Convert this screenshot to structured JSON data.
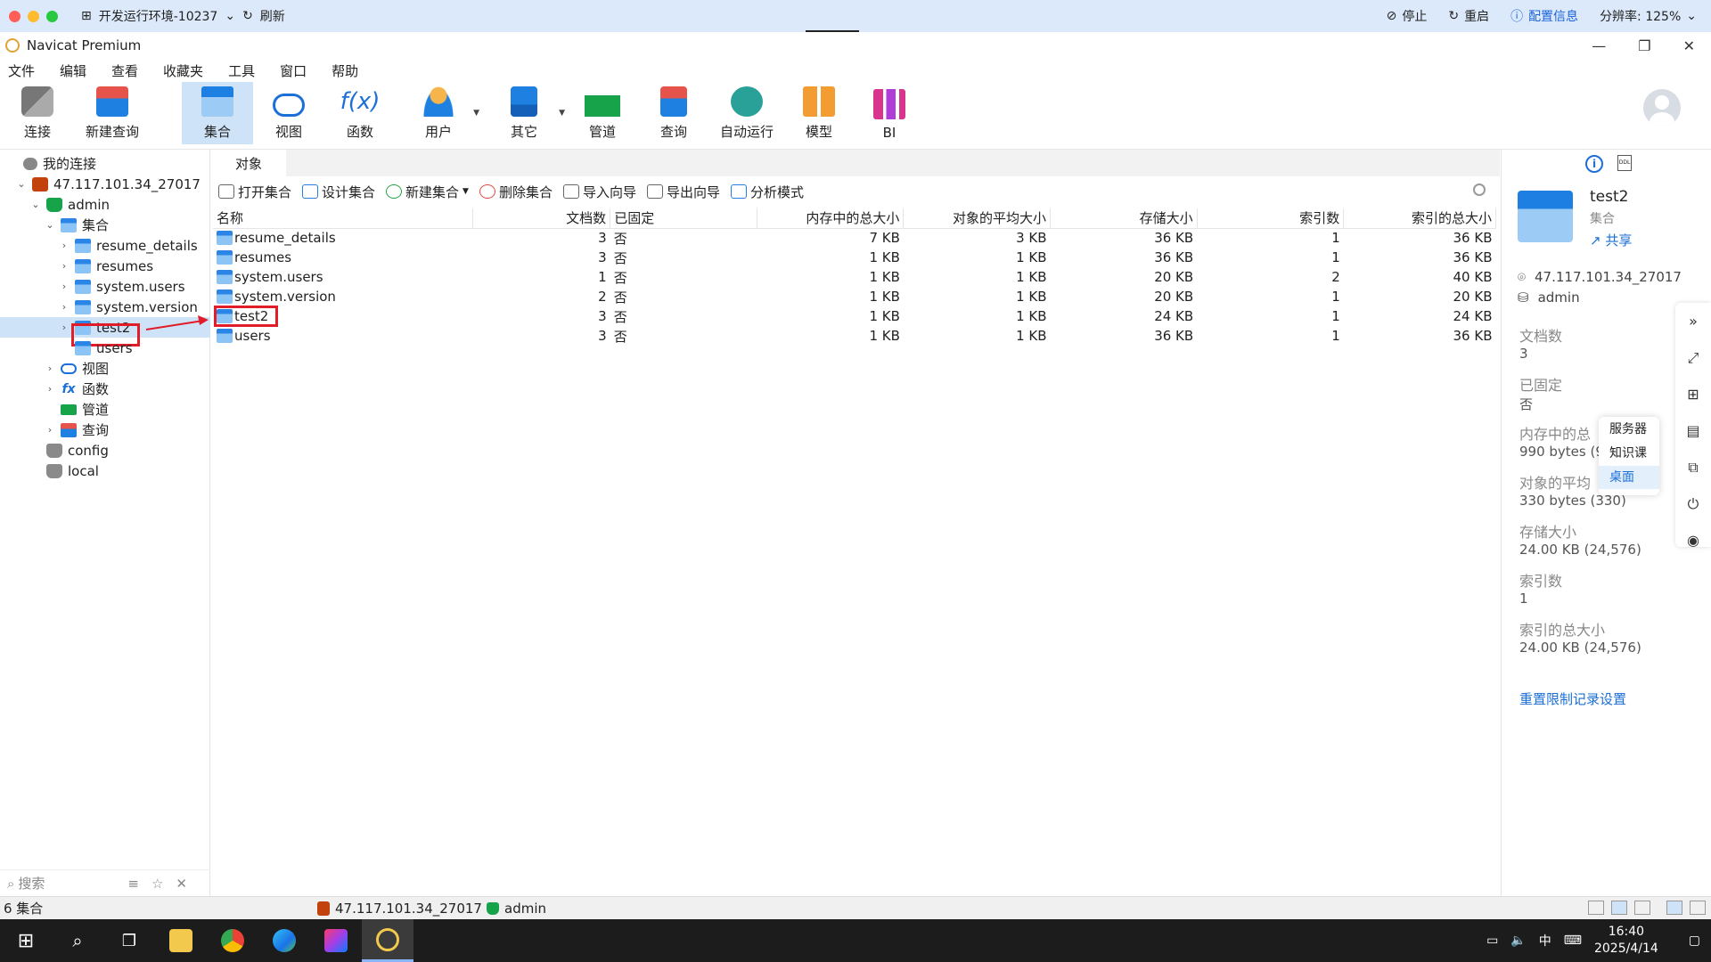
{
  "remote": {
    "env_title": "开发运行环境-10237",
    "refresh": "刷新",
    "stop": "停止",
    "restart": "重启",
    "config_info": "配置信息",
    "resolution": "分辨率: 125%"
  },
  "window": {
    "title": "Navicat Premium"
  },
  "menu": [
    "文件",
    "编辑",
    "查看",
    "收藏夹",
    "工具",
    "窗口",
    "帮助"
  ],
  "toolbar": [
    "连接",
    "新建查询",
    "集合",
    "视图",
    "函数",
    "用户",
    "其它",
    "管道",
    "查询",
    "自动运行",
    "模型",
    "BI"
  ],
  "tree": {
    "my_connections": "我的连接",
    "server": "47.117.101.34_27017",
    "db_admin": "admin",
    "collections": "集合",
    "items": [
      "resume_details",
      "resumes",
      "system.users",
      "system.version",
      "test2",
      "users"
    ],
    "views": "视图",
    "functions": "函数",
    "pipelines": "管道",
    "queries": "查询",
    "db_config": "config",
    "db_local": "local",
    "search_placeholder": "搜索"
  },
  "objects": {
    "tab": "对象",
    "actions": [
      "打开集合",
      "设计集合",
      "新建集合",
      "删除集合",
      "导入向导",
      "导出向导",
      "分析模式"
    ],
    "columns": [
      "名称",
      "文档数",
      "已固定",
      "内存中的总大小",
      "对象的平均大小",
      "存储大小",
      "索引数",
      "索引的总大小"
    ],
    "rows": [
      [
        "resume_details",
        "3",
        "否",
        "7 KB",
        "3 KB",
        "36 KB",
        "1",
        "36 KB"
      ],
      [
        "resumes",
        "3",
        "否",
        "1 KB",
        "1 KB",
        "36 KB",
        "1",
        "36 KB"
      ],
      [
        "system.users",
        "1",
        "否",
        "1 KB",
        "1 KB",
        "20 KB",
        "2",
        "40 KB"
      ],
      [
        "system.version",
        "2",
        "否",
        "1 KB",
        "1 KB",
        "20 KB",
        "1",
        "20 KB"
      ],
      [
        "test2",
        "3",
        "否",
        "1 KB",
        "1 KB",
        "24 KB",
        "1",
        "24 KB"
      ],
      [
        "users",
        "3",
        "否",
        "1 KB",
        "1 KB",
        "36 KB",
        "1",
        "36 KB"
      ]
    ]
  },
  "info": {
    "name": "test2",
    "type": "集合",
    "share": "共享",
    "server": "47.117.101.34_27017",
    "database": "admin",
    "doc_count_label": "文档数",
    "doc_count": "3",
    "capped_label": "已固定",
    "capped": "否",
    "mem_size_label": "内存中的总",
    "mem_size": "990 bytes (9",
    "avg_obj_label": "对象的平均",
    "avg_obj": "330 bytes (330)",
    "storage_label": "存储大小",
    "storage": "24.00 KB (24,576)",
    "index_count_label": "索引数",
    "index_count": "1",
    "index_size_label": "索引的总大小",
    "index_size": "24.00 KB (24,576)",
    "reset_link": "重置限制记录设置"
  },
  "popup": [
    "服务器",
    "知识课",
    "桌面"
  ],
  "status": {
    "count": "6 集合",
    "server": "47.117.101.34_27017",
    "database": "admin"
  },
  "taskbar": {
    "time": "16:40",
    "date": "2025/4/14",
    "ime": "中"
  }
}
